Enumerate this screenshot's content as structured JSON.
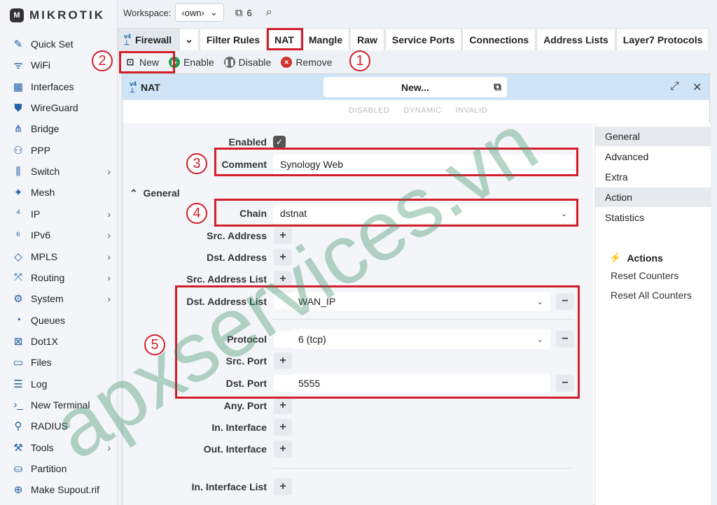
{
  "brand": {
    "name": "MIKROTIK"
  },
  "sidebar": {
    "items": [
      {
        "label": "Quick Set",
        "icon": "wand-icon",
        "glyph": "✎",
        "chevron": false
      },
      {
        "label": "WiFi",
        "icon": "wifi-icon",
        "glyph": "ᯤ",
        "chevron": false
      },
      {
        "label": "Interfaces",
        "icon": "interfaces-icon",
        "glyph": "▦",
        "chevron": false
      },
      {
        "label": "WireGuard",
        "icon": "shield-icon",
        "glyph": "⛊",
        "chevron": false
      },
      {
        "label": "Bridge",
        "icon": "bridge-icon",
        "glyph": "⋔",
        "chevron": false
      },
      {
        "label": "PPP",
        "icon": "ppp-icon",
        "glyph": "⚇",
        "chevron": false
      },
      {
        "label": "Switch",
        "icon": "switch-icon",
        "glyph": "⫼",
        "chevron": true
      },
      {
        "label": "Mesh",
        "icon": "mesh-icon",
        "glyph": "✦",
        "chevron": false
      },
      {
        "label": "IP",
        "icon": "ipv4-icon",
        "glyph": "⁴",
        "chevron": true
      },
      {
        "label": "IPv6",
        "icon": "ipv6-icon",
        "glyph": "⁶",
        "chevron": true
      },
      {
        "label": "MPLS",
        "icon": "tag-icon",
        "glyph": "◇",
        "chevron": true
      },
      {
        "label": "Routing",
        "icon": "routing-icon",
        "glyph": "⤧",
        "chevron": true
      },
      {
        "label": "System",
        "icon": "gear-icon",
        "glyph": "⚙",
        "chevron": true
      },
      {
        "label": "Queues",
        "icon": "gauge-icon",
        "glyph": "◔",
        "chevron": false
      },
      {
        "label": "Dot1X",
        "icon": "dot1x-icon",
        "glyph": "⊠",
        "chevron": false
      },
      {
        "label": "Files",
        "icon": "folder-icon",
        "glyph": "▭",
        "chevron": false
      },
      {
        "label": "Log",
        "icon": "log-icon",
        "glyph": "☰",
        "chevron": false
      },
      {
        "label": "New Terminal",
        "icon": "terminal-icon",
        "glyph": "›_",
        "chevron": false
      },
      {
        "label": "RADIUS",
        "icon": "radius-icon",
        "glyph": "⚲",
        "chevron": false
      },
      {
        "label": "Tools",
        "icon": "tools-icon",
        "glyph": "⚒",
        "chevron": true
      },
      {
        "label": "Partition",
        "icon": "partition-icon",
        "glyph": "⛀",
        "chevron": false
      },
      {
        "label": "Make Supout.rif",
        "icon": "supout-icon",
        "glyph": "⊕",
        "chevron": false
      }
    ]
  },
  "topbar": {
    "workspace_label": "Workspace:",
    "workspace_value": "‹own›",
    "window_count": "6"
  },
  "tabs": {
    "head": "Firewall",
    "items": [
      "Filter Rules",
      "NAT",
      "Mangle",
      "Raw",
      "Service Ports",
      "Connections",
      "Address Lists",
      "Layer7 Protocols"
    ]
  },
  "toolbar": {
    "new": "New",
    "enable": "Enable",
    "disable": "Disable",
    "remove": "Remove"
  },
  "dialog": {
    "title": "NAT",
    "name": "New...",
    "flags": [
      "DISABLED",
      "DYNAMIC",
      "INVALID"
    ],
    "enabled_label": "Enabled",
    "comment_label": "Comment",
    "comment_value": "Synology Web",
    "section_general": "General",
    "chain_label": "Chain",
    "chain_value": "dstnat",
    "src_address": "Src. Address",
    "dst_address": "Dst. Address",
    "src_address_list": "Src. Address List",
    "dst_address_list": "Dst. Address List",
    "dst_address_list_value": "WAN_IP",
    "protocol": "Protocol",
    "protocol_value": "6 (tcp)",
    "src_port": "Src. Port",
    "dst_port": "Dst. Port",
    "dst_port_value": "5555",
    "any_port": "Any. Port",
    "in_interface": "In. Interface",
    "out_interface": "Out. Interface",
    "in_interface_list": "In. Interface List"
  },
  "right_panel": {
    "tabs": [
      "General",
      "Advanced",
      "Extra",
      "Action",
      "Statistics"
    ],
    "actions_title": "Actions",
    "actions": [
      "Reset Counters",
      "Reset All Counters"
    ]
  },
  "annotations": {
    "badges": [
      "1",
      "2",
      "3",
      "4",
      "5"
    ]
  },
  "watermark": {
    "text": "apxservices.vn",
    "color": "#2f8a5e"
  }
}
